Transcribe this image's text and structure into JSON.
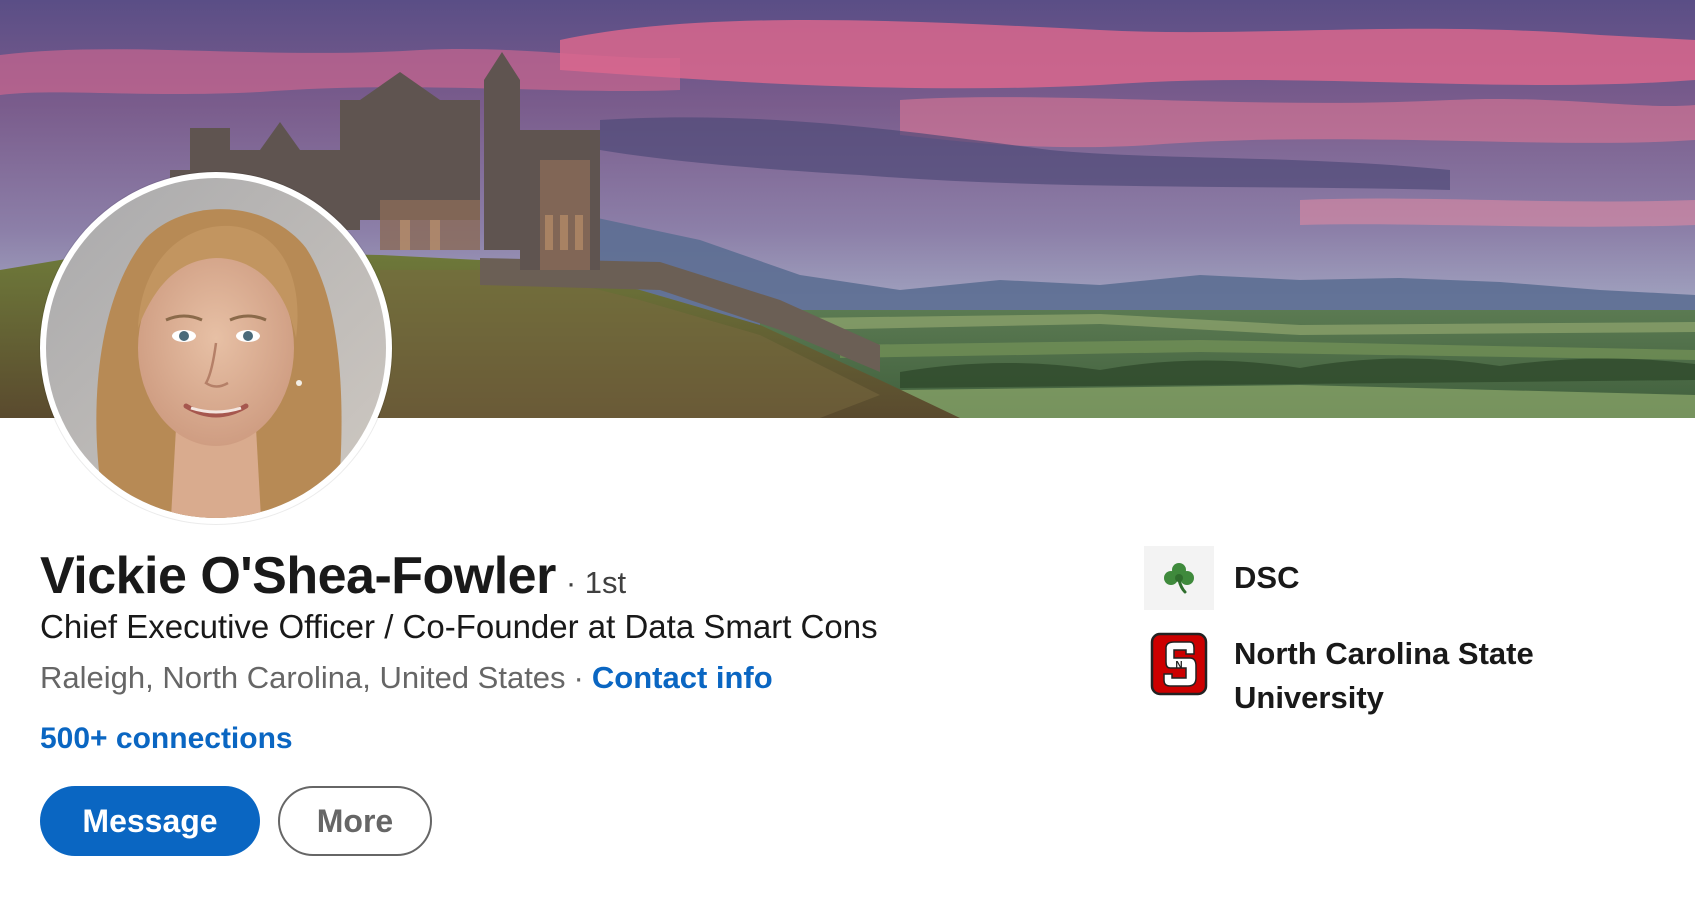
{
  "profile": {
    "name": "Vickie O'Shea-Fowler",
    "degree": "· 1st",
    "headline": "Chief Executive Officer / Co-Founder at Data Smart Cons",
    "location": "Raleigh, North Carolina, United States",
    "location_separator": "·",
    "contact_info_label": "Contact info",
    "connections_label": "500+ connections"
  },
  "actions": {
    "message_label": "Message",
    "more_label": "More"
  },
  "experience_summary": [
    {
      "name": "DSC",
      "icon": "shamrock-logo-icon"
    },
    {
      "name": "North Carolina State University",
      "icon": "ncsu-logo-icon"
    }
  ],
  "banner": {
    "icon": "castle-landscape-banner-image"
  },
  "colors": {
    "link": "#0a66c2",
    "primary_button": "#0a66c2",
    "ncsu_red": "#cc0000",
    "shamrock_green": "#3f8a3c"
  }
}
